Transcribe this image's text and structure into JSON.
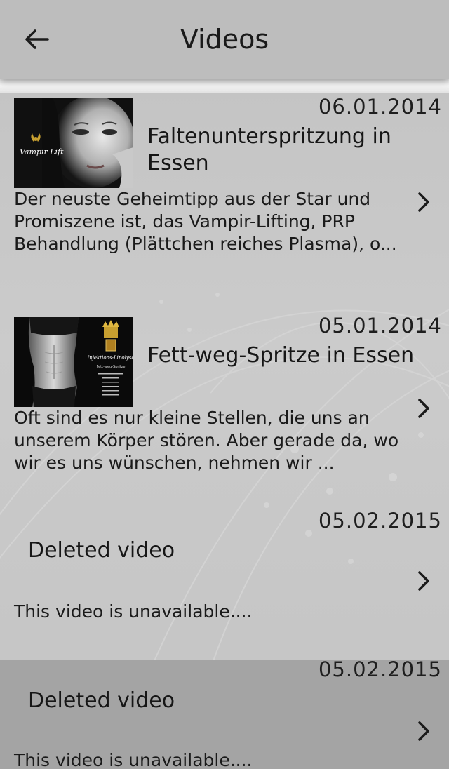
{
  "header": {
    "title": "Videos",
    "back_icon": "arrow-left-icon"
  },
  "videos": [
    {
      "date": "06.01.2014",
      "title": "Faltenunterspritzung in Essen",
      "description": "Der neuste Geheimtipp aus der Star und Promiszene ist, das Vampir-Lifting, PRP Behandlung (Plättchen reiches Plasma), o...",
      "thumbnail_caption": "Vampir Lift",
      "chevron_icon": "chevron-right-icon"
    },
    {
      "date": "05.01.2014",
      "title": "Fett-weg-Spritze in Essen",
      "description": "Oft sind es nur kleine Stellen, die uns an unserem Körper stören. Aber gerade da, wo wir es uns wünschen, nehmen wir ...",
      "thumbnail_caption": "Injektions-Lipolyse",
      "thumbnail_subcaption": "Fett-weg-Spritze",
      "chevron_icon": "chevron-right-icon"
    },
    {
      "date": "05.02.2015",
      "title": "Deleted video",
      "description": "This video is unavailable....",
      "chevron_icon": "chevron-right-icon"
    },
    {
      "date": "05.02.2015",
      "title": "Deleted video",
      "description": "This video is unavailable....",
      "chevron_icon": "chevron-right-icon"
    }
  ],
  "colors": {
    "header_bg": "#bdbdbd",
    "page_bg": "#c6c6c6",
    "selected_row_bg": "#a4a4a4",
    "text": "#1a1a1a"
  }
}
